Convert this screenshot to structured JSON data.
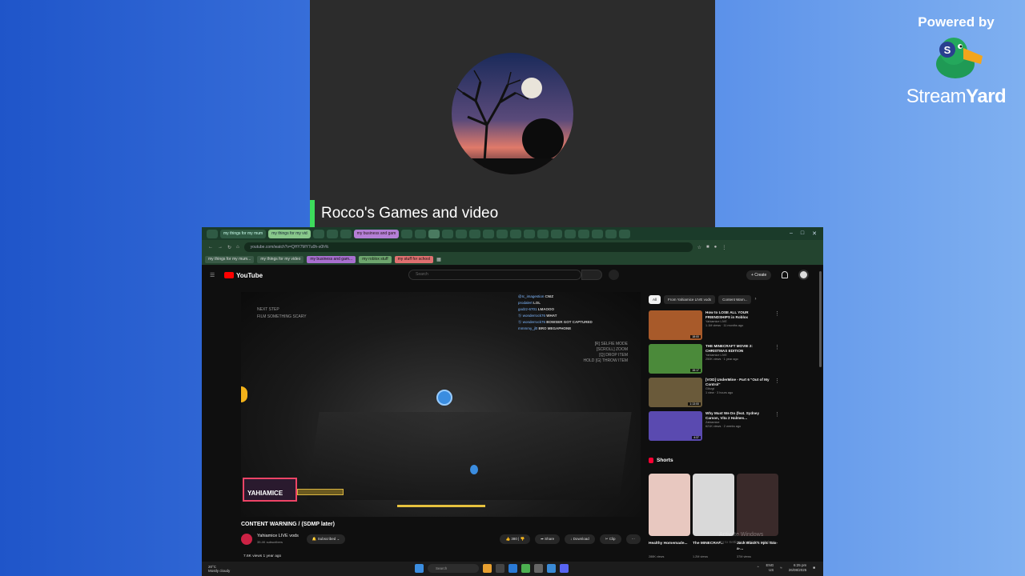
{
  "streamyard": {
    "powered_by": "Powered by",
    "brand_light": "Stream",
    "brand_bold": "Yard"
  },
  "camera": {
    "name": "Rocco's Games and video"
  },
  "browser": {
    "tabs": [
      {
        "label": "my things for my mum",
        "style": "normal"
      },
      {
        "label": "my things for my vid",
        "style": "g"
      },
      {
        "label": "my business and gam",
        "style": "p"
      }
    ],
    "url": "youtube.com/watch?v=QHY7MY7u0h-s0h%",
    "bookmarks": [
      {
        "label": "my things for my mum...",
        "style": "normal"
      },
      {
        "label": "my things for my video",
        "style": "normal"
      },
      {
        "label": "my business and gam...",
        "style": "p"
      },
      {
        "label": "my roblox stuff",
        "style": "g2"
      },
      {
        "label": "my stuff for school",
        "style": "r"
      }
    ]
  },
  "youtube": {
    "logo": "YouTube",
    "search_placeholder": "Search",
    "create": "+ Create",
    "player": {
      "chat": [
        {
          "user": "@Ic_imagestion",
          "msg": "CNIZ"
        },
        {
          "user": "prodalert",
          "msg": "LOL"
        },
        {
          "user": "godzz-6701",
          "msg": "LMAOOO"
        },
        {
          "user": "Ⓢ wonderrock76",
          "msg": "WHAT"
        },
        {
          "user": "Ⓢ wonderrock76",
          "msg": "BOWSER GOT CAPTURED"
        },
        {
          "user": "mmmmy_jl0",
          "msg": "BRO MEGAPHONE"
        }
      ],
      "hud_left": [
        "NEXT STEP",
        "FILM SOMETHING SCARY"
      ],
      "hud_right": [
        "[R] SELFIE MODE",
        "[SCROLL] ZOOM",
        "[Q] DROP ITEM",
        "HOLD [G] THROW ITEM"
      ],
      "badge": "YAHIAMICE"
    },
    "video": {
      "title": "CONTENT WARNING / (SDMP later)",
      "channel": "Yahiamice LIVE vods",
      "subscribers": "35.4K subscribers",
      "subscribed": "Subscribed",
      "likes": "380",
      "share": "Share",
      "download": "Download",
      "clip": "Clip",
      "views": "7.6K views  1 year ago"
    },
    "chips": [
      "All",
      "From Yahiamice LIVE vods",
      "Content Warn..."
    ],
    "recommended": [
      {
        "title": "How to LOSE ALL YOUR FRIENDSHIPS in Roblox",
        "channel": "Yahiamice LIVE",
        "meta": "1.1M views · 11 months ago",
        "dur": "18:00",
        "color": "#a85a2a"
      },
      {
        "title": "THE MINECRAFT MOVIE 2: CHRISTMAS EDITION",
        "channel": "Yahiamice LIVE",
        "meta": "250K views · 1 year ago",
        "dur": "15:17",
        "color": "#4b8a3a"
      },
      {
        "title": "[VOD] UnderMine - Part 6 \"Out of My Control\"",
        "channel": "Glkvgt",
        "meta": "1 view · 3 hours ago",
        "dur": "1:13:00",
        "color": "#6a5a3a"
      },
      {
        "title": "Why Must We Do (feat. Sydney Carson, Vita 2 Halmes...",
        "channel": "Zahiamice",
        "meta": "621K views · 2 weeks ago",
        "dur": "4:37",
        "color": "#5a4ab0"
      }
    ],
    "shorts_label": "Shorts",
    "shorts": [
      {
        "title": "Healthy Homemade...",
        "views": "288K views",
        "color": "#e8c8c0"
      },
      {
        "title": "The MINECRAF...",
        "views": "1.2M views",
        "color": "#d9d9d9"
      },
      {
        "title": "Jack Black's epic Sax-a-...",
        "views": "37M views",
        "color": "#3a2a2a"
      }
    ],
    "activate": {
      "title": "Activate Windows",
      "sub": "Go to Settings to activate Windows."
    }
  },
  "taskbar": {
    "weather_temp": "20°C",
    "weather_desc": "Mostly cloudy",
    "search": "Search",
    "lang": "ENG",
    "region": "US",
    "time": "6:25 pm",
    "date": "26/08/2025"
  }
}
